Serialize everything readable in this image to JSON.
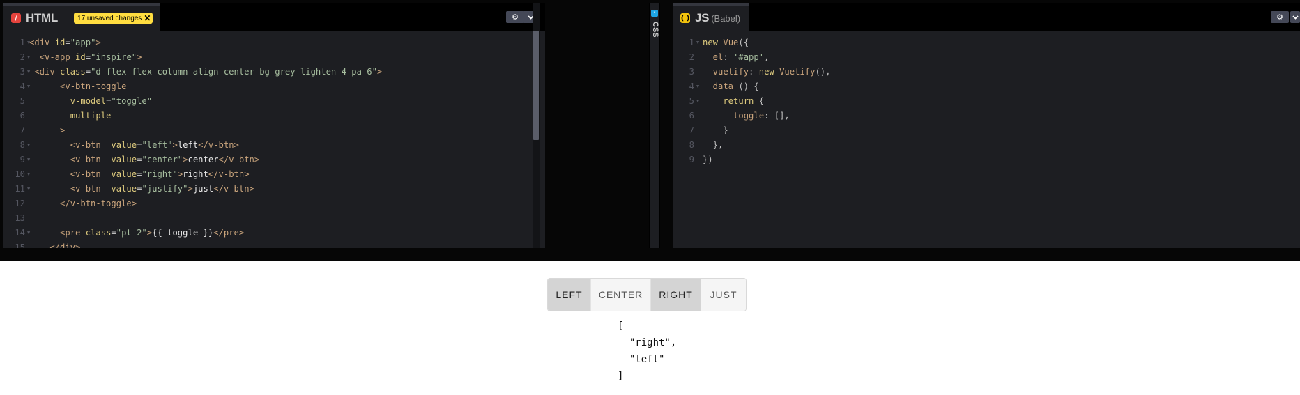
{
  "html_panel": {
    "title": "HTML",
    "unsaved_label": "17 unsaved changes",
    "unsaved_close": "✕",
    "lines": [
      [
        {
          "t": "<div ",
          "c": "tg"
        },
        {
          "t": "id",
          "c": "at"
        },
        {
          "t": "=",
          "c": "pu"
        },
        {
          "t": "\"app\"",
          "c": "st"
        },
        {
          "t": ">",
          "c": "tg"
        }
      ],
      [
        {
          "t": "  <v-app ",
          "c": "tg"
        },
        {
          "t": "id",
          "c": "at"
        },
        {
          "t": "=",
          "c": "pu"
        },
        {
          "t": "\"inspire\"",
          "c": "st"
        },
        {
          "t": ">",
          "c": "tg"
        }
      ],
      [
        {
          "t": " <div ",
          "c": "tg"
        },
        {
          "t": "class",
          "c": "at"
        },
        {
          "t": "=",
          "c": "pu"
        },
        {
          "t": "\"d-flex flex-column align-center bg-grey-lighten-4 pa-6\"",
          "c": "st"
        },
        {
          "t": ">",
          "c": "tg"
        }
      ],
      [
        {
          "t": "      <v-btn-toggle",
          "c": "tg"
        }
      ],
      [
        {
          "t": "        v-model",
          "c": "at"
        },
        {
          "t": "=",
          "c": "pu"
        },
        {
          "t": "\"toggle\"",
          "c": "st"
        }
      ],
      [
        {
          "t": "        multiple",
          "c": "at"
        }
      ],
      [
        {
          "t": "      >",
          "c": "tg"
        }
      ],
      [
        {
          "t": "        <v-btn  ",
          "c": "tg"
        },
        {
          "t": "value",
          "c": "at"
        },
        {
          "t": "=",
          "c": "pu"
        },
        {
          "t": "\"left\"",
          "c": "st"
        },
        {
          "t": ">",
          "c": "tg"
        },
        {
          "t": "left",
          "c": "tx"
        },
        {
          "t": "</v-btn>",
          "c": "tg"
        }
      ],
      [
        {
          "t": "        <v-btn  ",
          "c": "tg"
        },
        {
          "t": "value",
          "c": "at"
        },
        {
          "t": "=",
          "c": "pu"
        },
        {
          "t": "\"center\"",
          "c": "st"
        },
        {
          "t": ">",
          "c": "tg"
        },
        {
          "t": "center",
          "c": "tx"
        },
        {
          "t": "</v-btn>",
          "c": "tg"
        }
      ],
      [
        {
          "t": "        <v-btn  ",
          "c": "tg"
        },
        {
          "t": "value",
          "c": "at"
        },
        {
          "t": "=",
          "c": "pu"
        },
        {
          "t": "\"right\"",
          "c": "st"
        },
        {
          "t": ">",
          "c": "tg"
        },
        {
          "t": "right",
          "c": "tx"
        },
        {
          "t": "</v-btn>",
          "c": "tg"
        }
      ],
      [
        {
          "t": "        <v-btn  ",
          "c": "tg"
        },
        {
          "t": "value",
          "c": "at"
        },
        {
          "t": "=",
          "c": "pu"
        },
        {
          "t": "\"justify\"",
          "c": "st"
        },
        {
          "t": ">",
          "c": "tg"
        },
        {
          "t": "just",
          "c": "tx"
        },
        {
          "t": "</v-btn>",
          "c": "tg"
        }
      ],
      [
        {
          "t": "      </v-btn-toggle>",
          "c": "tg"
        }
      ],
      [],
      [
        {
          "t": "      <pre ",
          "c": "tg"
        },
        {
          "t": "class",
          "c": "at"
        },
        {
          "t": "=",
          "c": "pu"
        },
        {
          "t": "\"pt-2\"",
          "c": "st"
        },
        {
          "t": ">",
          "c": "tg"
        },
        {
          "t": "{{ toggle }}",
          "c": "tx"
        },
        {
          "t": "</pre>",
          "c": "tg"
        }
      ],
      [
        {
          "t": "    </div>",
          "c": "tg"
        }
      ]
    ],
    "folds": [
      1,
      2,
      3,
      4,
      8,
      9,
      10,
      11,
      14
    ]
  },
  "css_panel": {
    "label": "CSS"
  },
  "js_panel": {
    "title": "JS",
    "subtitle": "(Babel)",
    "lines": [
      [
        {
          "t": "new ",
          "c": "kw"
        },
        {
          "t": "Vue",
          "c": "id"
        },
        {
          "t": "({",
          "c": "pu"
        }
      ],
      [
        {
          "t": "  el",
          "c": "id"
        },
        {
          "t": ": ",
          "c": "pu"
        },
        {
          "t": "'#app'",
          "c": "st"
        },
        {
          "t": ",",
          "c": "pu"
        }
      ],
      [
        {
          "t": "  vuetify",
          "c": "id"
        },
        {
          "t": ": ",
          "c": "pu"
        },
        {
          "t": "new ",
          "c": "kw"
        },
        {
          "t": "Vuetify",
          "c": "id"
        },
        {
          "t": "(),",
          "c": "pu"
        }
      ],
      [
        {
          "t": "  data ",
          "c": "id"
        },
        {
          "t": "() {",
          "c": "pu"
        }
      ],
      [
        {
          "t": "    return ",
          "c": "kw"
        },
        {
          "t": "{",
          "c": "pu"
        }
      ],
      [
        {
          "t": "      toggle",
          "c": "id"
        },
        {
          "t": ": [],",
          "c": "pu"
        }
      ],
      [
        {
          "t": "    }",
          "c": "pu"
        }
      ],
      [
        {
          "t": "  },",
          "c": "pu"
        }
      ],
      [
        {
          "t": "})",
          "c": "pu"
        }
      ]
    ],
    "folds": [
      1,
      4,
      5
    ]
  },
  "preview": {
    "buttons": [
      {
        "label": "LEFT",
        "active": true
      },
      {
        "label": "CENTER",
        "active": false
      },
      {
        "label": "RIGHT",
        "active": true
      },
      {
        "label": "JUST",
        "active": false
      }
    ],
    "pre_lines": [
      "[",
      "  \"right\",",
      "  \"left\"",
      "]"
    ]
  },
  "colors": {
    "html_logo": "#e5433d",
    "js_logo": "#f2c30d",
    "css_logo": "#1ea6e6",
    "unsaved_badge": "#ffdd40"
  },
  "icons": {
    "settings": "gear-icon",
    "collapse": "chevron-down-icon"
  }
}
